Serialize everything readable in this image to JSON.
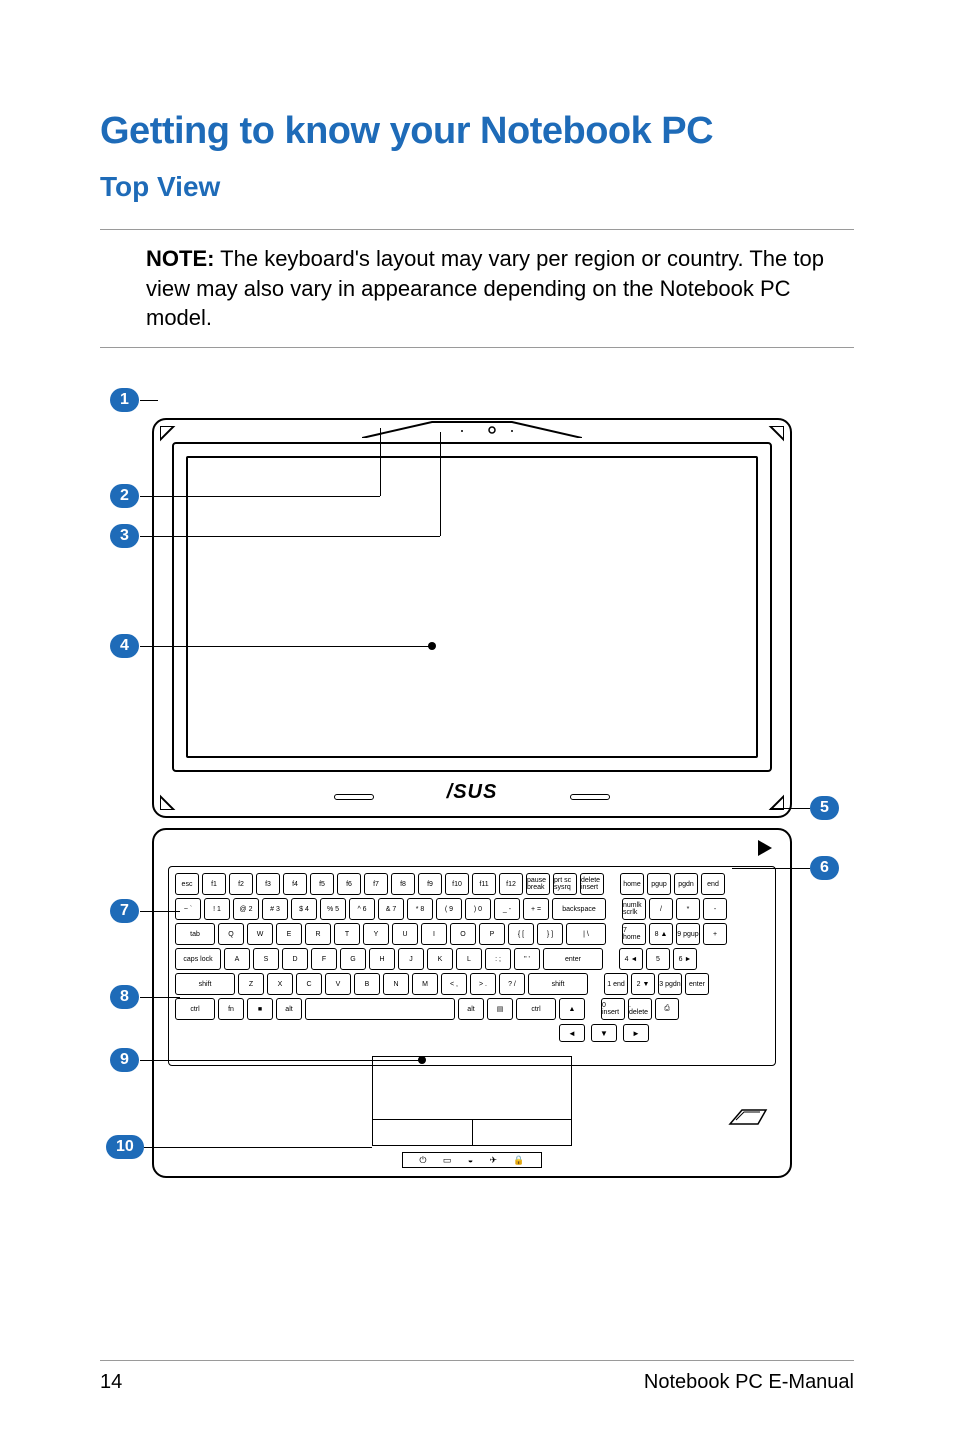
{
  "heading": "Getting to know your Notebook PC",
  "subheading": "Top View",
  "note": {
    "label": "NOTE:",
    "text": " The keyboard's layout may vary per region or country. The top view may also vary in appearance depending on the Notebook PC model."
  },
  "brand_logo_text": "/SUS",
  "callouts": {
    "c1": "1",
    "c2": "2",
    "c3": "3",
    "c4": "4",
    "c5": "5",
    "c6": "6",
    "c7": "7",
    "c8": "8",
    "c9": "9",
    "c10": "10"
  },
  "keys": {
    "esc": "esc",
    "f1": "f1",
    "f2": "f2",
    "f3": "f3",
    "f4": "f4",
    "f5": "f5",
    "f6": "f6",
    "f7": "f7",
    "f8": "f8",
    "f9": "f9",
    "f10": "f10",
    "f11": "f11",
    "f12": "f12",
    "pause": "pause break",
    "prtsc": "prt sc sysrq",
    "del": "delete insert",
    "home": "home",
    "pgup": "pgup",
    "pgdn": "pgdn",
    "end": "end",
    "tilde": "~ `",
    "n1": "! 1",
    "n2": "@ 2",
    "n3": "# 3",
    "n4": "$ 4",
    "n5": "% 5",
    "n6": "^ 6",
    "n7": "& 7",
    "n8": "* 8",
    "n9": "( 9",
    "n0": ") 0",
    "min": "_ -",
    "eq": "+ =",
    "bksp": "backspace",
    "numlk": "numlk scrlk",
    "div": "/",
    "mul": "*",
    "sub": "-",
    "tab": "tab",
    "q": "Q",
    "w": "W",
    "e": "E",
    "r": "R",
    "t": "T",
    "y": "Y",
    "u": "U",
    "i": "I",
    "o": "O",
    "p": "P",
    "lb": "{ [",
    "rb": "} ]",
    "bsl": "| \\",
    "k7": "7 home",
    "k8": "8 ▲",
    "k9": "9 pgup",
    "plus": "+",
    "caps": "caps lock",
    "a": "A",
    "s": "S",
    "d": "D",
    "f": "F",
    "g": "G",
    "h": "H",
    "j": "J",
    "k": "K",
    "l": "L",
    "sc": ": ;",
    "qt": "\" '",
    "ent": "enter",
    "k4": "4 ◄",
    "k5": "5",
    "k6": "6 ►",
    "lsh": "shift",
    "z": "Z",
    "x": "X",
    "c": "C",
    "v": "V",
    "b": "B",
    "n": "N",
    "m": "M",
    "cm": "< ,",
    "pd": "> .",
    "sl": "? /",
    "rsh": "shift",
    "k1": "1 end",
    "k2": "2 ▼",
    "k3": "3 pgdn",
    "kent": "enter",
    "ctrl": "ctrl",
    "fn": "fn",
    "win": "■",
    "alt": "alt",
    "space": "",
    "ralt": "alt",
    "menu": "▤",
    "rctrl": "ctrl",
    "up": "▲",
    "k0": "0 insert",
    "kdot": ". delete",
    "kprt": "⎙",
    "left": "◄",
    "down": "▼",
    "right": "►"
  },
  "footer": {
    "page": "14",
    "title": "Notebook PC E-Manual"
  }
}
